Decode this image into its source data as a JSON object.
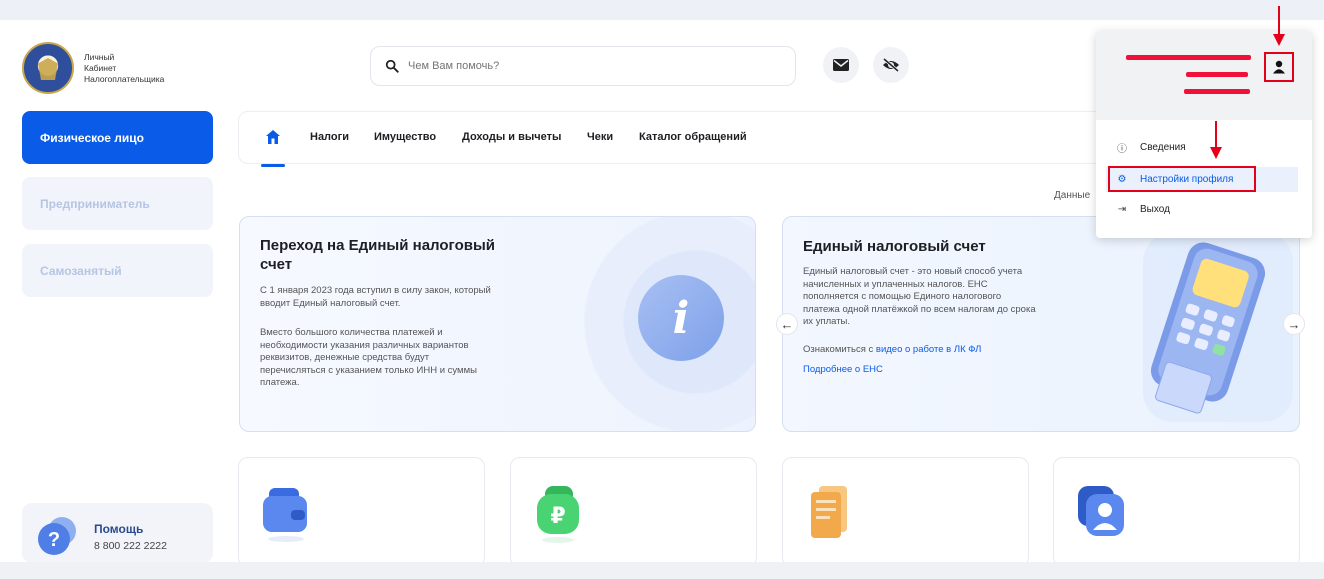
{
  "logo": {
    "line1": "Личный",
    "line2": "Кабинет",
    "line3": "Налогоплательщика"
  },
  "search": {
    "placeholder": "Чем Вам помочь?"
  },
  "header_icons": [
    "mail-icon",
    "eye-off-icon"
  ],
  "sidebar": {
    "items": [
      {
        "label": "Физическое лицо",
        "active": true
      },
      {
        "label": "Предприниматель",
        "active": false
      },
      {
        "label": "Самозанятый",
        "active": false
      }
    ],
    "help": {
      "title": "Помощь",
      "phone": "8 800 222 2222"
    }
  },
  "nav": {
    "items": [
      "Налоги",
      "Имущество",
      "Доходы и вычеты",
      "Чеки",
      "Каталог обращений"
    ]
  },
  "data_label": "Данные",
  "card1": {
    "title_line1": "Переход на Единый налоговый",
    "title_line2": "счет",
    "para1_line1": "С 1 января 2023 года вступил в силу закон, который",
    "para1_line2": "вводит Единый налоговый счет.",
    "para2_line1": "Вместо большого количества платежей и",
    "para2_line2": "необходимости указания различных вариантов",
    "para2_line3": "реквизитов, денежные средства будут",
    "para2_line4": "перечисляться с указанием только ИНН и суммы",
    "para2_line5": "платежа."
  },
  "card2": {
    "title": "Единый налоговый счет",
    "text_line1": "Единый налоговый счет - это новый способ учета",
    "text_line2": "начисленных и уплаченных налогов. ЕНС",
    "text_line3": "пополняется с помощью Единого налогового",
    "text_line4": "платежа одной платёжкой по всем налогам до срока",
    "text_line5": "их уплаты.",
    "watch_prefix": "Ознакомиться с",
    "watch_link": "видео о работе в ЛК ФЛ",
    "more_link": "Подробнее о ЕНС"
  },
  "dropdown": {
    "items": [
      {
        "label": "Сведения",
        "icon": "info-icon"
      },
      {
        "label": "Настройки профиля",
        "icon": "gear-icon",
        "highlighted": true
      },
      {
        "label": "Выход",
        "icon": "logout-icon"
      }
    ]
  },
  "colors": {
    "primary": "#0a5ce8",
    "annotation_red": "#e4001b",
    "redaction": "#f0103a"
  }
}
